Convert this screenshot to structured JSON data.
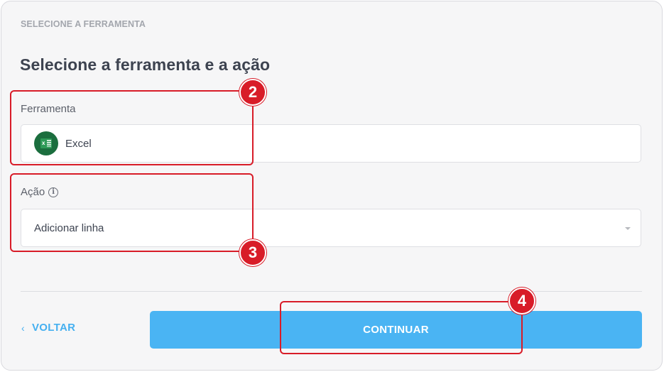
{
  "header": {
    "eyebrow": "SELECIONE A FERRAMENTA",
    "title": "Selecione a ferramenta e a ação"
  },
  "tool_field": {
    "label": "Ferramenta",
    "value": "Excel",
    "icon": "excel-icon"
  },
  "action_field": {
    "label": "Ação",
    "info_icon": "info-icon",
    "info_glyph": "i",
    "value": "Adicionar linha",
    "icon": "chevron-down-icon"
  },
  "footer": {
    "back_chevron": "‹",
    "back_label": "VOLTAR",
    "continue_label": "CONTINUAR"
  },
  "annotations": [
    "2",
    "3",
    "4"
  ],
  "colors": {
    "accent": "#4ab4f3",
    "link": "#46b0f0",
    "annotation": "#d81c28",
    "excel": "#1b6e3e"
  }
}
